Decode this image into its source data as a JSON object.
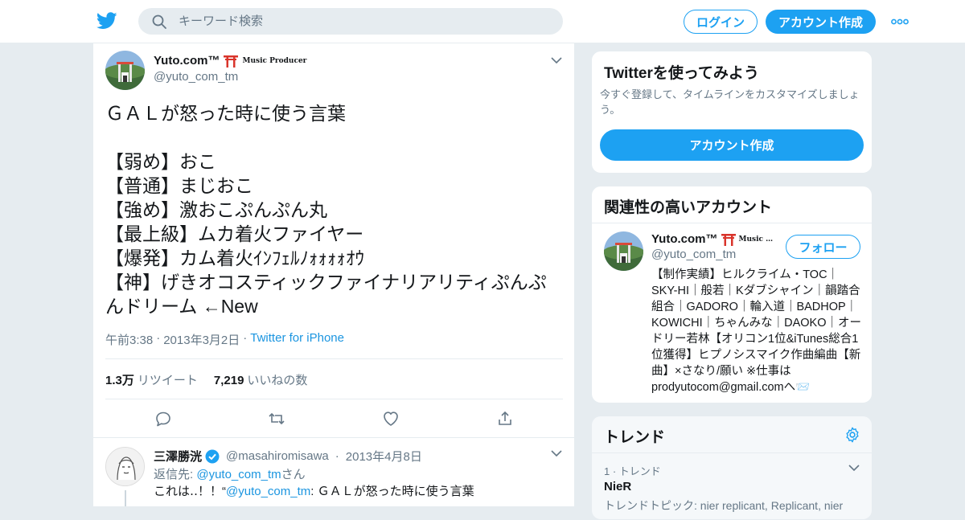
{
  "colors": {
    "accent": "#1da1f2",
    "link": "#1b95e0",
    "muted": "#657786",
    "background": "#e6ecf0"
  },
  "header": {
    "search_placeholder": "キーワード検索",
    "login_label": "ログイン",
    "signup_label": "アカウント作成"
  },
  "tweet": {
    "display_name": "Yuto.com™",
    "name_badge": "Music Producer",
    "handle": "@yuto_com_tm",
    "text": "ＧＡＬが怒った時に使う言葉\n\n【弱め】おこ\n【普通】まじおこ\n【強め】激おこぷんぷん丸\n【最上級】ムカ着火ファイヤー\n【爆発】カム着火ｲﾝﾌｪﾙﾉｫｫｫｫｵｳ\n【神】げきオコスティックファイナリアリティぷんぷんドリーム ←New",
    "time": "午前3:38",
    "date": "2013年3月2日",
    "dot": "·",
    "client": "Twitter for iPhone",
    "retweets_count": "1.3万",
    "retweets_label": "リツイート",
    "likes_count": "7,219",
    "likes_label": "いいねの数"
  },
  "reply": {
    "display_name": "三澤勝洸",
    "handle": "@masahiromisawa",
    "dot": "·",
    "date": "2013年4月8日",
    "reply_to_prefix": "返信先: ",
    "reply_to_handle": "@yuto_com_tm",
    "reply_to_suffix": "さん",
    "text_prefix": "これは‥！！“",
    "text_mention": "@yuto_com_tm",
    "text_suffix": ": ＧＡＬが怒った時に使う言葉"
  },
  "signup_card": {
    "title": "Twitterを使ってみよう",
    "description": "今すぐ登録して、タイムラインをカスタマイズしましょう。",
    "button_label": "アカウント作成"
  },
  "related": {
    "title": "関連性の高いアカウント",
    "account": {
      "display_name": "Yuto.com™",
      "name_badge": "Music …",
      "handle": "@yuto_com_tm",
      "follow_label": "フォロー",
      "bio": "【制作実績】ヒルクライム・TOC｜SKY-HI｜般若｜Kダブシャイン｜韻踏合組合｜GADORO｜輪入道｜BADHOP｜KOWICHI｜ちゃんみな｜DAOKO｜オードリー若林【オリコン1位&iTunes総合1位獲得】ヒプノシスマイク作曲編曲【新曲】×さなり/願い ※仕事はprodyutocom@gmail.comへ📨"
    }
  },
  "trends": {
    "title": "トレンド",
    "items": [
      {
        "meta": "1 · トレンド",
        "name": "NieR",
        "topics": "トレンドトピック: nier replicant, Replicant, nier"
      }
    ]
  }
}
